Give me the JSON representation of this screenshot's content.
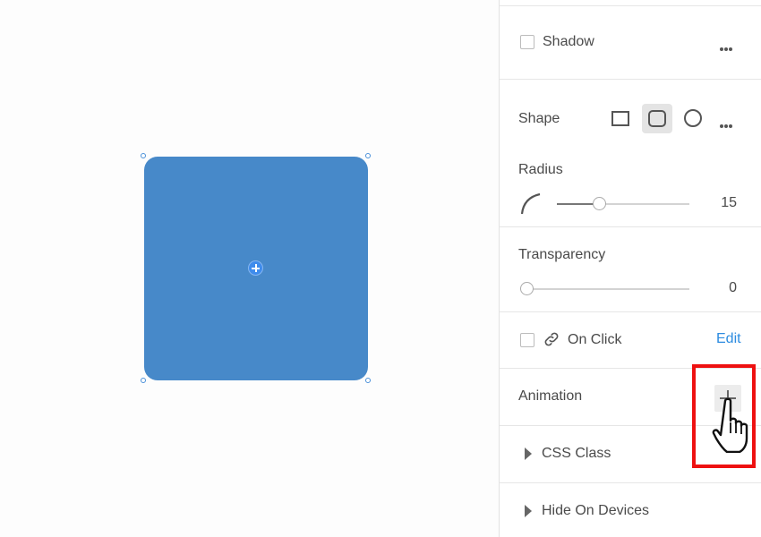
{
  "colors": {
    "shape_fill": "#4789c9",
    "accent_link": "#2d8ce0",
    "highlight": "#ee1111"
  },
  "canvas": {
    "shape": {
      "corner_radius_value": 15
    }
  },
  "panel": {
    "shadow": {
      "label": "Shadow",
      "checked": false,
      "more_icon": "more-horizontal-icon"
    },
    "shape": {
      "label": "Shape",
      "options": [
        "square",
        "rounded",
        "circle"
      ],
      "selected": "rounded"
    },
    "radius": {
      "label": "Radius",
      "value": "15",
      "slider_fraction": 0.32,
      "icon": "corner-radius-icon"
    },
    "transparency": {
      "label": "Transparency",
      "value": "0",
      "slider_fraction": 0
    },
    "on_click": {
      "label": "On Click",
      "edit_label": "Edit",
      "icon": "link-icon",
      "checked": false
    },
    "animation": {
      "label": "Animation",
      "add_icon": "plus-icon"
    },
    "css_class": {
      "label": "CSS Class",
      "expanded": false
    },
    "hide_on_devices": {
      "label": "Hide On Devices",
      "expanded": false
    }
  }
}
